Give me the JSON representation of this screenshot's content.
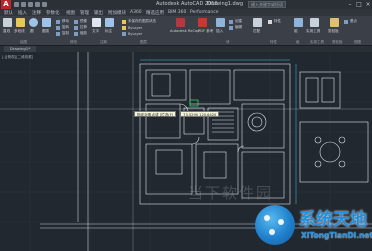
{
  "titlebar": {
    "logo": "A",
    "title": "Autodesk AutoCAD 2016",
    "filename": "Drawing1.dwg",
    "search_placeholder": "键入关键字或短语",
    "minimize": "–",
    "maximize": "□",
    "close": "×"
  },
  "tabs": [
    "默认",
    "插入",
    "注释",
    "参数化",
    "视图",
    "管理",
    "输出",
    "附加模块",
    "A360",
    "精选应用",
    "BIM 360",
    "Performance"
  ],
  "ribbon": {
    "buttons": [
      "直线",
      "多段线",
      "圆",
      "圆弧",
      "移动",
      "旋转",
      "复制",
      "镜像",
      "拉伸",
      "缩放",
      "文字",
      "标注"
    ],
    "small": [
      "未保存的图层状态",
      "ByLayer",
      "ByLayer",
      "插入",
      "创建",
      "编辑",
      "匹配",
      "特性",
      "组",
      "实用工具",
      "剪贴板",
      "基点"
    ],
    "panels": [
      "绘图",
      "修改",
      "注释",
      "图层",
      "块",
      "特性",
      "组",
      "实用工具",
      "剪贴板",
      "视图"
    ],
    "mid_labels": [
      "Autodesk ReCap",
      "PDF 参考"
    ]
  },
  "drawing": {
    "file_tab": "Drawing1*",
    "view_label": "[-][俯视][二维线框]",
    "tooltip_key": "指定对角点或 [栏选(F)",
    "tooltip_value": "73.5290   120.6420"
  },
  "watermark": {
    "brand": "系统天地",
    "site": "XiTongTianDi.net",
    "faint": "当下软件园"
  },
  "colors": {
    "background": "#212830",
    "ribbon": "#3b4048",
    "lines": "#d8dde2",
    "accent": "#1f8fe0"
  }
}
